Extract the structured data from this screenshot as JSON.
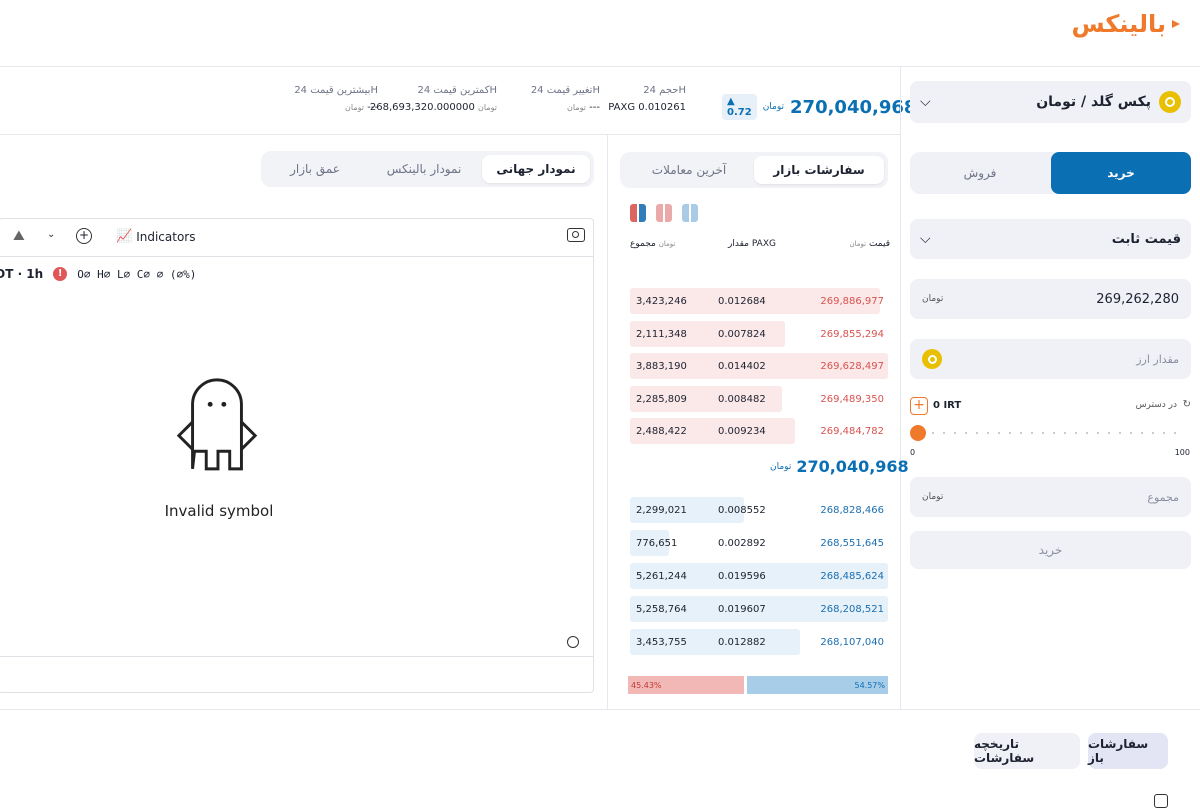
{
  "brand": {
    "name": "بالینکس"
  },
  "stats": {
    "last_price": "270,040,968",
    "currency": "تومان",
    "change_pct": "0.72",
    "volume_label": "حجم 24H",
    "volume_value": "PAXG 0.010261",
    "change_label": "تغییر قیمت 24H",
    "change_value": "---",
    "low_label": "کمترین قیمت 24H",
    "low_value": "268,693,320.000000",
    "high_label": "بیشترین قیمت 24H",
    "high_value": "---"
  },
  "trade": {
    "market_name": "پکس گلد / تومان",
    "buy_label": "خرید",
    "sell_label": "فروش",
    "order_type": "قیمت ثابت",
    "price_value": "269,262,280",
    "price_unit": "تومان",
    "amount_placeholder": "مقدار ارز",
    "available_label": "در دسترس",
    "available_value": "0 IRT",
    "slider_percent": 0,
    "slider_min": "0",
    "slider_max": "100",
    "total_placeholder": "مجموع",
    "submit_label": "خرید"
  },
  "book": {
    "tab_orders": "سفارشات بازار",
    "tab_trades": "آخرین معاملات",
    "col_price": "قیمت",
    "col_amount": "مقدار PAXG",
    "col_total": "مجموع",
    "asks": [
      {
        "price": "269,886,977",
        "amount": "0.012684",
        "total": "3,423,246",
        "depth": 0.97
      },
      {
        "price": "269,855,294",
        "amount": "0.007824",
        "total": "2,111,348",
        "depth": 0.6
      },
      {
        "price": "269,628,497",
        "amount": "0.014402",
        "total": "3,883,190",
        "depth": 1.0
      },
      {
        "price": "269,489,350",
        "amount": "0.008482",
        "total": "2,285,809",
        "depth": 0.59
      },
      {
        "price": "269,484,782",
        "amount": "0.009234",
        "total": "2,488,422",
        "depth": 0.64
      }
    ],
    "mid_price": "270,040,968",
    "bids": [
      {
        "price": "268,828,466",
        "amount": "0.008552",
        "total": "2,299,021",
        "depth": 0.44
      },
      {
        "price": "268,551,645",
        "amount": "0.002892",
        "total": "776,651",
        "depth": 0.15
      },
      {
        "price": "268,485,624",
        "amount": "0.019596",
        "total": "5,261,244",
        "depth": 1.0
      },
      {
        "price": "268,208,521",
        "amount": "0.019607",
        "total": "5,258,764",
        "depth": 1.0
      },
      {
        "price": "268,107,040",
        "amount": "0.012882",
        "total": "3,453,755",
        "depth": 0.66
      }
    ],
    "sell_pct": "45.43%",
    "buy_pct": "54.57%",
    "sell_ratio": 0.4543
  },
  "chart": {
    "tab_global": "نمودار جهانی",
    "tab_balinex": "نمودار بالینکس",
    "tab_depth": "عمق بازار",
    "indicators_label": "Indicators",
    "symbol_text": "OT · 1h",
    "ohlc_text": "O∅ H∅ L∅ C∅ ∅ (∅%)",
    "invalid_text": "Invalid symbol"
  },
  "bottom": {
    "tab_open": "سفارشات باز",
    "tab_history": "تاریخچه سفارشات"
  },
  "colors": {
    "primary": "#0b6fb4",
    "ask": "#d9534f",
    "bid": "#1b6fb1",
    "ask_bg": "#fbe8e8",
    "bid_bg": "#e6f1f9",
    "brand": "#f07a2b"
  }
}
